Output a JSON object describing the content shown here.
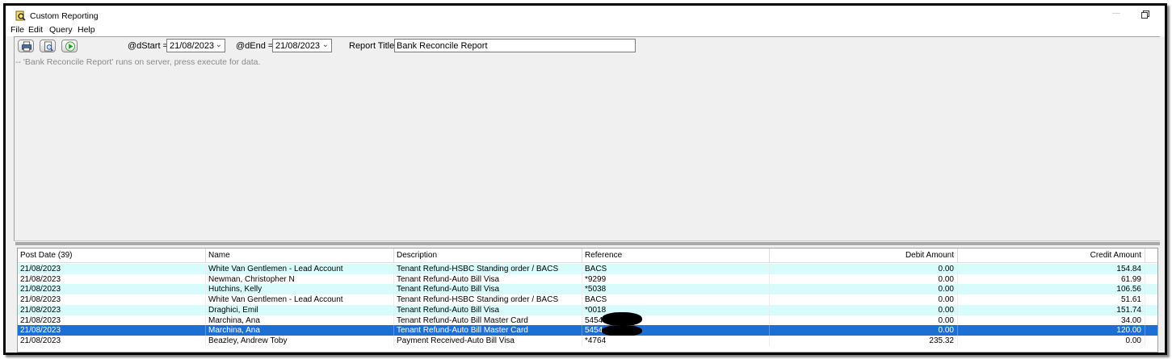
{
  "window": {
    "title": "Custom Reporting"
  },
  "menu": [
    "File",
    "Edit",
    "Query",
    "Help"
  ],
  "toolbar": {
    "dstart_label": "@dStart =",
    "dstart_value": "21/08/2023",
    "dend_label": "@dEnd =",
    "dend_value": "21/08/2023",
    "report_title_label": "Report Title",
    "report_title_value": "Bank Reconcile Report"
  },
  "sql": {
    "text": "-- 'Bank Reconcile Report' runs on server, press execute for data."
  },
  "grid": {
    "columns": [
      "Post Date (39)",
      "Name",
      "Description",
      "Reference",
      "Debit Amount",
      "Credit Amount"
    ],
    "rows": [
      {
        "date": "21/08/2023",
        "name": "White Van Gentlemen - Lead Account",
        "desc": "Tenant Refund-HSBC Standing order / BACS",
        "ref": "BACS",
        "debit": "0.00",
        "credit": "154.84",
        "style": "cyan"
      },
      {
        "date": "21/08/2023",
        "name": "Newman, Christopher N",
        "desc": "Tenant Refund-Auto Bill Visa",
        "ref": "*9299",
        "debit": "0.00",
        "credit": "61.99",
        "style": "white"
      },
      {
        "date": "21/08/2023",
        "name": "Hutchins, Kelly",
        "desc": "Tenant Refund-Auto Bill Visa",
        "ref": "*5038",
        "debit": "0.00",
        "credit": "106.56",
        "style": "cyan"
      },
      {
        "date": "21/08/2023",
        "name": "White Van Gentlemen - Lead Account",
        "desc": "Tenant Refund-HSBC Standing order / BACS",
        "ref": "BACS",
        "debit": "0.00",
        "credit": "51.61",
        "style": "white"
      },
      {
        "date": "21/08/2023",
        "name": "Draghici, Emil",
        "desc": "Tenant Refund-Auto Bill Visa",
        "ref": "*0018",
        "debit": "0.00",
        "credit": "151.74",
        "style": "cyan"
      },
      {
        "date": "21/08/2023",
        "name": "Marchina, Ana",
        "desc": "Tenant Refund-Auto Bill Master Card",
        "ref": "5454              12",
        "debit": "0.00",
        "credit": "34.00",
        "style": "white"
      },
      {
        "date": "21/08/2023",
        "name": "Marchina, Ana",
        "desc": "Tenant Refund-Auto Bill Master Card",
        "ref": "5454              12",
        "debit": "0.00",
        "credit": "120.00",
        "style": "selected"
      },
      {
        "date": "21/08/2023",
        "name": "Beazley, Andrew Toby",
        "desc": "Payment Received-Auto Bill Visa",
        "ref": "*4764",
        "debit": "235.32",
        "credit": "0.00",
        "style": "white"
      }
    ]
  },
  "icons": [
    "app-icon",
    "print-icon",
    "print-preview-icon",
    "execute-icon",
    "chevron-down-icon",
    "restore-icon"
  ]
}
